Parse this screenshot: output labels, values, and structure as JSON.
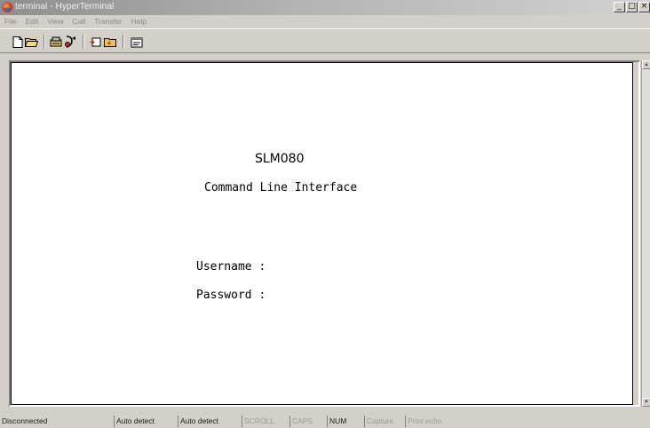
{
  "window": {
    "title": "terminal - HyperTerminal",
    "controls": {
      "minimize": "_",
      "maximize": "□",
      "close": "×"
    }
  },
  "menu": {
    "items": [
      "File",
      "Edit",
      "View",
      "Call",
      "Transfer",
      "Help"
    ]
  },
  "toolbar": {
    "buttons": [
      "new-icon",
      "open-icon",
      "connect-icon",
      "disconnect-icon",
      "send-icon",
      "receive-icon",
      "properties-icon"
    ]
  },
  "terminal": {
    "device": "SLM080",
    "subtitle": "Command Line Interface",
    "username_prompt": "Username :",
    "password_prompt": "Password :"
  },
  "status": {
    "connection": "Disconnected",
    "detect1": "Auto detect",
    "detect2": "Auto detect",
    "scroll": "SCROLL",
    "caps": "CAPS",
    "num": "NUM",
    "capture": "Capture",
    "print_echo": "Print echo"
  },
  "colors": {
    "titlebar_start": "#8f8f92",
    "titlebar_end": "#d2d2d3",
    "chrome": "#d4d0c8",
    "screen": "#ffffff",
    "icon_accent": "#c8341a"
  }
}
